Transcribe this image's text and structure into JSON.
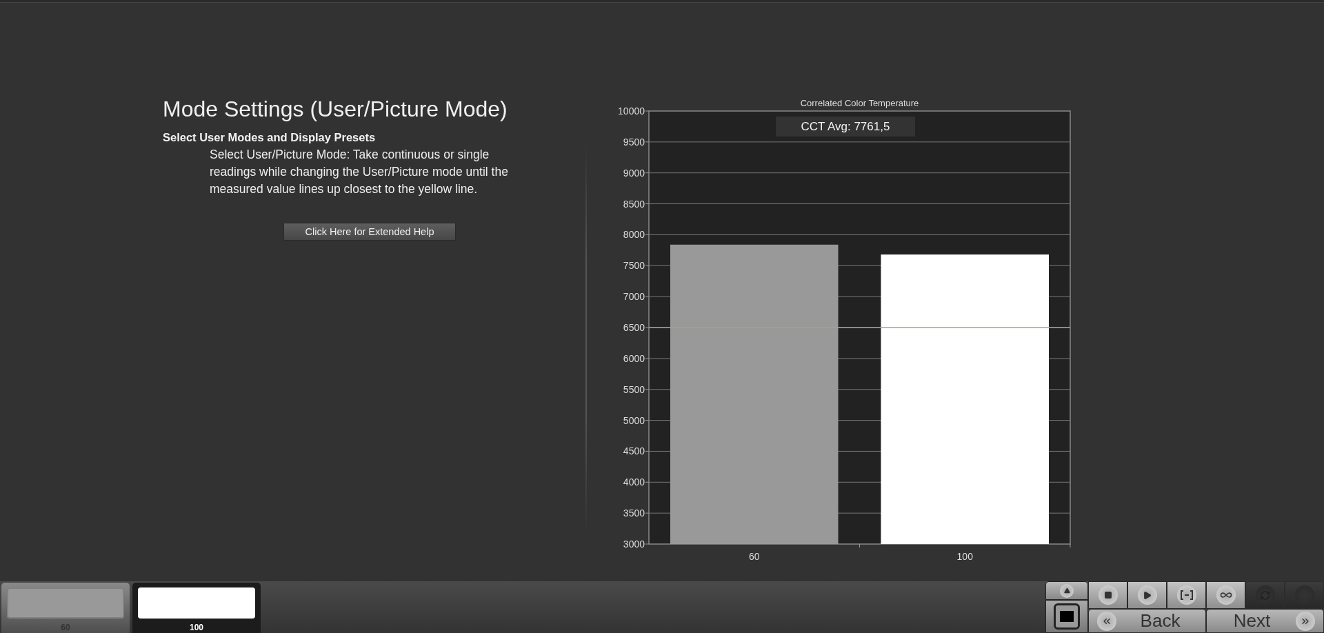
{
  "heading": {
    "title": "Mode Settings (User/Picture Mode)",
    "subtitle": "Select User Modes and Display Presets",
    "description": "Select User/Picture Mode: Take continuous or single readings while changing the User/Picture mode until the measured value lines up closest to the yellow line."
  },
  "help_button": "Click Here for Extended Help",
  "chart": {
    "average_label": "CCT Avg: 7761,5",
    "chart_data": {
      "type": "bar",
      "title": "Correlated Color Temperature",
      "categories": [
        "60",
        "100"
      ],
      "values": [
        7840,
        7680
      ],
      "grid": true,
      "ylim": [
        3000,
        10000
      ],
      "yticks": [
        3000,
        3500,
        4000,
        4500,
        5000,
        5500,
        6000,
        6500,
        7000,
        7500,
        8000,
        8500,
        9000,
        9500,
        10000
      ],
      "ref_lines": [
        {
          "axis": "y",
          "value": 6500,
          "color": "#c8a038"
        }
      ]
    }
  },
  "swatches": [
    {
      "label": "60",
      "color": "#999999",
      "selected": false
    },
    {
      "label": "100",
      "color": "#ffffff",
      "selected": true
    }
  ],
  "side_controls": [
    {
      "kind": "up"
    },
    {
      "kind": "stop"
    }
  ],
  "toolbar": [
    {
      "kind": "stop",
      "disabled": false
    },
    {
      "kind": "play",
      "disabled": false
    },
    {
      "kind": "range",
      "disabled": false
    },
    {
      "kind": "loop",
      "disabled": false
    },
    {
      "kind": "refresh",
      "disabled": true
    },
    {
      "kind": "record",
      "disabled": true
    }
  ],
  "nav": [
    {
      "kind": "back",
      "label": "Back"
    },
    {
      "kind": "next",
      "label": "Next"
    }
  ]
}
